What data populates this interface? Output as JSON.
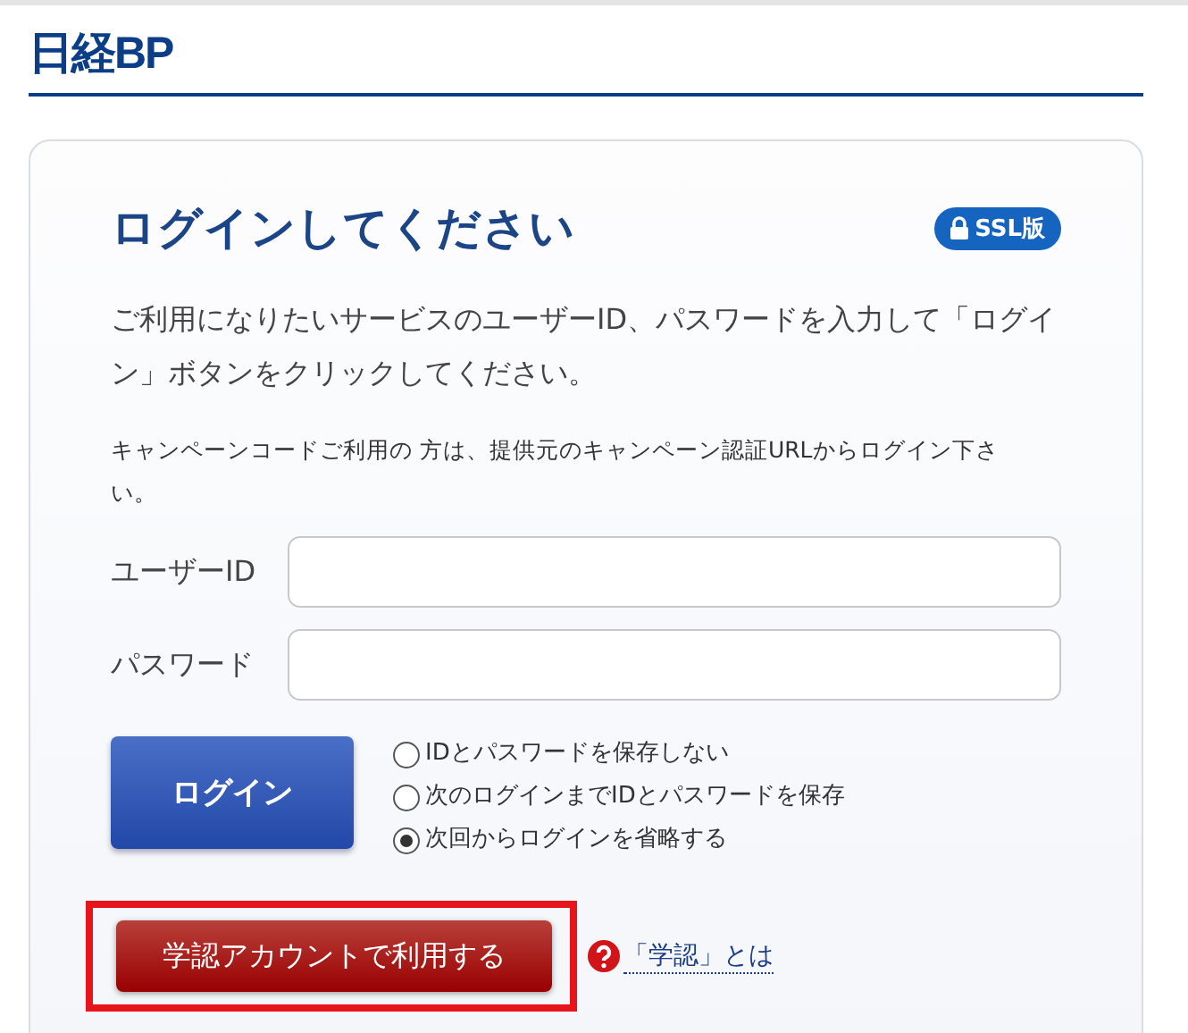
{
  "logo": "日経BP",
  "login_form": {
    "title": "ログインしてください",
    "ssl_badge": "SSL版",
    "intro": "ご利用になりたいサービスのユーザーID、パスワードを入力して「ログイン」ボタンをクリックしてください。",
    "note": "キャンペーンコードご利用の 方は、提供元のキャンペーン認証URLからログイン下さい。",
    "fields": [
      {
        "label": "ユーザーID"
      },
      {
        "label": "パスワード"
      }
    ],
    "login_button": "ログイン",
    "options": [
      {
        "label": "IDとパスワードを保存しない",
        "selected": false
      },
      {
        "label": "次のログインまでIDとパスワードを保存",
        "selected": false
      },
      {
        "label": "次回からログインを省略する",
        "selected": true
      }
    ],
    "gakunin_button": {
      "label": "学認アカウントで利用する",
      "highlighted": true
    },
    "help_link": "「学認」とは"
  }
}
